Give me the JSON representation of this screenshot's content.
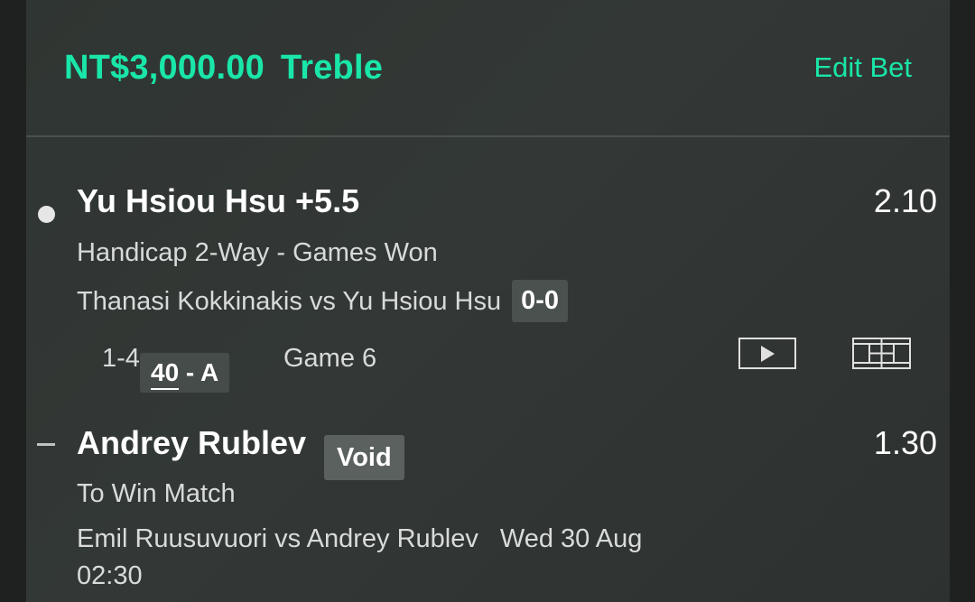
{
  "header": {
    "stake": "NT$3,000.00",
    "bet_type": "Treble",
    "edit_label": "Edit Bet"
  },
  "selections": [
    {
      "name": "Yu Hsiou Hsu +5.5",
      "odds": "2.10",
      "market": "Handicap 2-Way - Games Won",
      "event": "Thanasi Kokkinakis vs Yu Hsiou Hsu",
      "score": "0-0",
      "games": "1-4",
      "point_home": "40",
      "point_sep": " - ",
      "point_away": "A",
      "game_label": "Game 6",
      "status_icon": "white-dot-icon",
      "icons": [
        "play-video-icon",
        "tennis-court-icon"
      ]
    },
    {
      "name": "Andrey Rublev",
      "badge": "Void",
      "odds": "1.30",
      "market": "To Win Match",
      "event": "Emil Ruusuvuori vs Andrey Rublev",
      "date": "Wed 30 Aug",
      "time": "02:30",
      "status_icon": "dash-icon"
    }
  ],
  "colors": {
    "accent": "#19e6a8",
    "card": "#323735",
    "chip": "#4b514e"
  }
}
